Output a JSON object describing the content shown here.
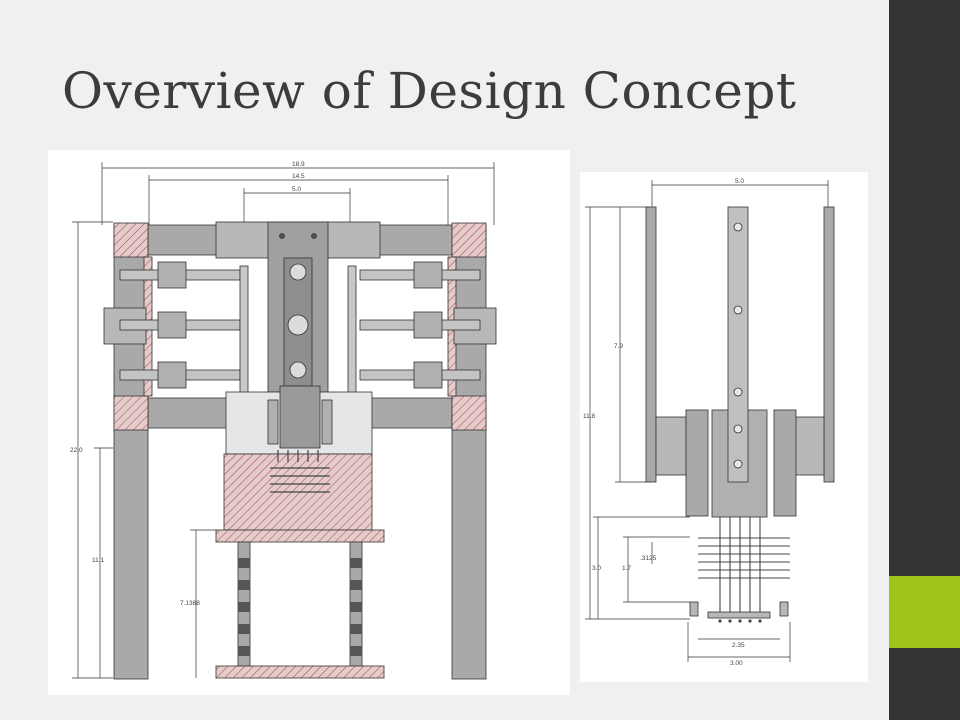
{
  "slide": {
    "title": "Overview of Design Concept"
  },
  "colors": {
    "sidebar": "#333333",
    "accent": "#9fc51d",
    "part_gray": "#a9a9a9",
    "hatch_red": "#c0504d"
  },
  "front_view": {
    "dimensions": {
      "overall_width": "18.9",
      "inner_width": "14.5",
      "center_width": "5.0",
      "total_height": "22.0",
      "leg_height": "11.1",
      "base_height": "7.1368"
    }
  },
  "side_view": {
    "dimensions": {
      "top_width": "5.0",
      "upper_height": "7.9",
      "total_height": "11.8",
      "lower_height": "3.0",
      "pin_height": "1.7",
      "pin_spacing": ".3125",
      "inner_base_width": "2.35",
      "outer_base_width": "3.00"
    }
  }
}
